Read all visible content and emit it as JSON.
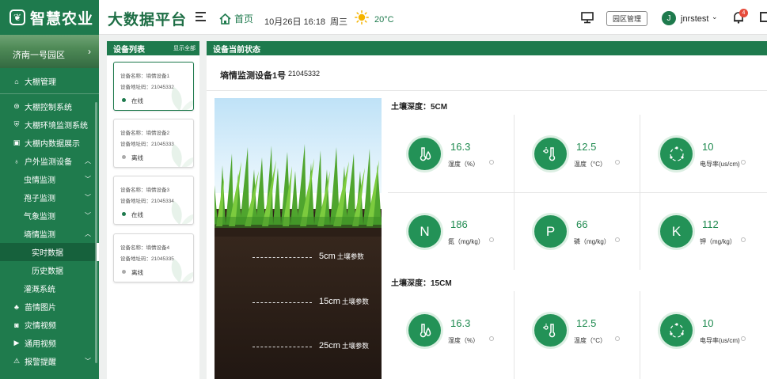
{
  "header": {
    "logo_text": "智慧农业",
    "platform_title": "大数据平台",
    "home_label": "首页",
    "datetime": "10月26日 16:18",
    "weekday": "周三",
    "temperature": "20°C",
    "park_manage_label": "园区管理",
    "avatar_initial": "J",
    "username": "jnrstest",
    "notification_count": "4"
  },
  "sidebar": {
    "park_name": "济南一号园区",
    "items": [
      {
        "label": "大棚管理",
        "icon": "home-icon"
      },
      {
        "label": "大棚控制系统",
        "icon": "control-icon"
      },
      {
        "label": "大棚环境监测系统",
        "icon": "shield-icon"
      },
      {
        "label": "大棚内数据展示",
        "icon": "doc-icon"
      },
      {
        "label": "户外监测设备",
        "icon": "water-icon"
      },
      {
        "label": "虫情监测"
      },
      {
        "label": "孢子监测"
      },
      {
        "label": "气象监测"
      },
      {
        "label": "墒情监测"
      },
      {
        "label": "实时数据"
      },
      {
        "label": "历史数据"
      },
      {
        "label": "灌溉系统"
      },
      {
        "label": "苗情图片",
        "icon": "plant-icon"
      },
      {
        "label": "灾情视频",
        "icon": "camera-icon"
      },
      {
        "label": "通用视频",
        "icon": "video-icon"
      },
      {
        "label": "报警提醒",
        "icon": "warning-icon"
      }
    ]
  },
  "device_list": {
    "title": "设备列表",
    "show_all": "显示全部",
    "devices": [
      {
        "name_line": "设备名称：墒情设备1",
        "addr_line": "设备地址码：21045332",
        "status": "在线",
        "status_color": "#1e7a4d"
      },
      {
        "name_line": "设备名称：墒情设备2",
        "addr_line": "设备地址码：21045333",
        "status": "离线",
        "status_color": "#aaaaaa"
      },
      {
        "name_line": "设备名称：墒情设备3",
        "addr_line": "设备地址码：21045334",
        "status": "在线",
        "status_color": "#1e7a4d"
      },
      {
        "name_line": "设备名称：墒情设备4",
        "addr_line": "设备地址码：21045335",
        "status": "离线",
        "status_color": "#aaaaaa"
      }
    ]
  },
  "status_panel": {
    "title": "设备当前状态",
    "device_name": "墒情监测设备1号",
    "device_addr": "21045332",
    "depth_labels": [
      {
        "depth": "5cm",
        "label": "土壤参数"
      },
      {
        "depth": "15cm",
        "label": "土壤参数"
      },
      {
        "depth": "25cm",
        "label": "土壤参数"
      }
    ],
    "sections": [
      {
        "title": "土壤深度：5CM",
        "cells": [
          {
            "icon": "humidity-icon",
            "value": "16.3",
            "unit": "湿度（%）"
          },
          {
            "icon": "thermometer-icon",
            "value": "12.5",
            "unit": "温度（°C）"
          },
          {
            "icon": "conductivity-icon",
            "value": "10",
            "unit": "电导率(us/cm)"
          },
          {
            "icon": "letter-n-icon",
            "glyph": "N",
            "value": "186",
            "unit": "氮（mg/kg）"
          },
          {
            "icon": "letter-p-icon",
            "glyph": "P",
            "value": "66",
            "unit": "磷（mg/kg）"
          },
          {
            "icon": "letter-k-icon",
            "glyph": "K",
            "value": "112",
            "unit": "钾（mg/kg）"
          }
        ]
      },
      {
        "title": "土壤深度：15CM",
        "cells": [
          {
            "icon": "humidity-icon",
            "value": "16.3",
            "unit": "湿度（%）"
          },
          {
            "icon": "thermometer-icon",
            "value": "12.5",
            "unit": "温度（°C）"
          },
          {
            "icon": "conductivity-icon",
            "value": "10",
            "unit": "电导率(us/cm)"
          }
        ]
      }
    ]
  }
}
